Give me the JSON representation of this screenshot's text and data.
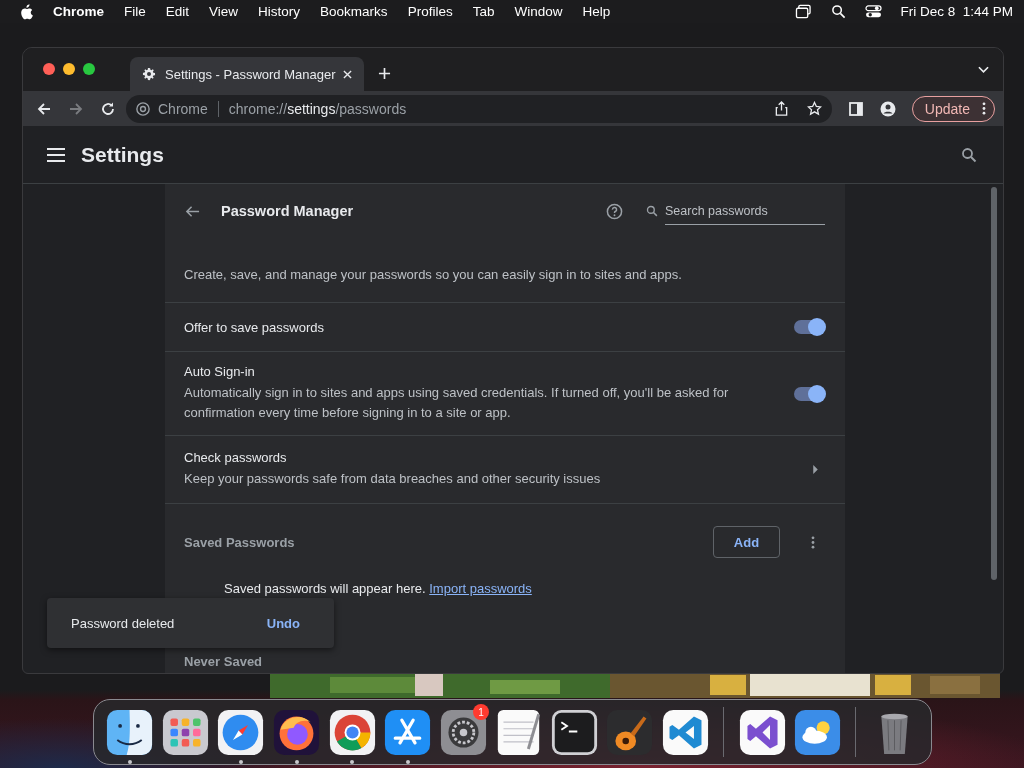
{
  "menu_bar": {
    "app": "Chrome",
    "items": [
      "File",
      "Edit",
      "View",
      "History",
      "Bookmarks",
      "Profiles",
      "Tab",
      "Window",
      "Help"
    ],
    "clock": "Fri Dec 8  1:44 PM"
  },
  "browser": {
    "tab": {
      "title": "Settings - Password Manager",
      "selected": true
    },
    "address": {
      "site_label": "Chrome",
      "scheme": "chrome://",
      "host": "settings",
      "path": "/passwords"
    },
    "update_button": "Update"
  },
  "settings": {
    "title": "Settings"
  },
  "page": {
    "title": "Password Manager",
    "search": {
      "placeholder": "Search passwords"
    },
    "description": "Create, save, and manage your passwords so you can easily sign in to sites and apps.",
    "rows": [
      {
        "kind": "toggle",
        "title": "Offer to save passwords",
        "on": true
      },
      {
        "kind": "toggle",
        "title": "Auto Sign-in",
        "subtitle": "Automatically sign in to sites and apps using saved credentials. If turned off, you'll be asked for confirmation every time before signing in to a site or app.",
        "on": true
      },
      {
        "kind": "link",
        "title": "Check passwords",
        "subtitle": "Keep your passwords safe from data breaches and other security issues"
      }
    ],
    "saved_passwords": {
      "heading": "Saved Passwords",
      "add_button": "Add",
      "empty_text": "Saved passwords will appear here.",
      "import_link": "Import passwords"
    },
    "never_saved": {
      "heading": "Never Saved"
    }
  },
  "toast": {
    "message": "Password deleted",
    "action": "Undo"
  },
  "dock": [
    {
      "kind": "finder",
      "running": true
    },
    {
      "kind": "launchpad",
      "running": false
    },
    {
      "kind": "safari",
      "running": true
    },
    {
      "kind": "firefox",
      "running": true
    },
    {
      "kind": "chrome",
      "running": true
    },
    {
      "kind": "appstore",
      "running": true
    },
    {
      "kind": "settings",
      "running": false,
      "badge": "1"
    },
    {
      "kind": "textedit",
      "running": false
    },
    {
      "kind": "terminal",
      "running": false
    },
    {
      "kind": "garageband",
      "running": false
    },
    {
      "kind": "vscode",
      "running": false
    },
    {
      "kind": "separator"
    },
    {
      "kind": "vs",
      "running": false
    },
    {
      "kind": "weather",
      "running": false
    },
    {
      "kind": "separator"
    },
    {
      "kind": "trash",
      "running": false
    }
  ]
}
